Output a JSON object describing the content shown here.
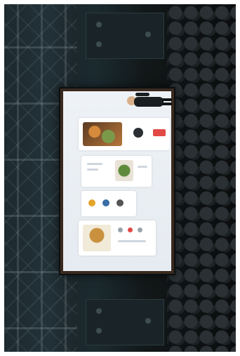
{
  "scene": {
    "subject": "stage-presentation",
    "orientation": "rotated-90"
  },
  "colors": {
    "accent_red": "#e24a46",
    "screen_bg": "#eef2f6",
    "stage_dark": "#0b0d0e"
  }
}
